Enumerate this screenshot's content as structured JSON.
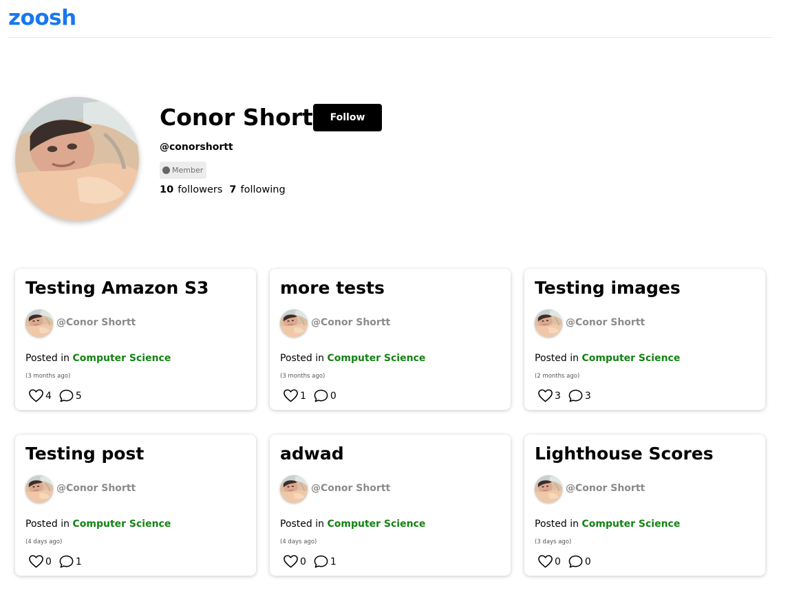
{
  "header": {
    "logo": "zoosh"
  },
  "profile": {
    "name": "Conor Shortt",
    "follow_label": "Follow",
    "handle": "@conorshortt",
    "badge": "Member",
    "followers_count": "10",
    "followers_label": "followers",
    "following_count": "7",
    "following_label": "following"
  },
  "posts": [
    {
      "title": "Testing Amazon S3",
      "author": "@Conor Shortt",
      "posted_prefix": "Posted in",
      "category": "Computer Science",
      "time": "(3 months ago)",
      "likes": "4",
      "comments": "5"
    },
    {
      "title": "more tests",
      "author": "@Conor Shortt",
      "posted_prefix": "Posted in",
      "category": "Computer Science",
      "time": "(3 months ago)",
      "likes": "1",
      "comments": "0"
    },
    {
      "title": "Testing images",
      "author": "@Conor Shortt",
      "posted_prefix": "Posted in",
      "category": "Computer Science",
      "time": "(2 months ago)",
      "likes": "3",
      "comments": "3"
    },
    {
      "title": "Testing post",
      "author": "@Conor Shortt",
      "posted_prefix": "Posted in",
      "category": "Computer Science",
      "time": "(4 days ago)",
      "likes": "0",
      "comments": "1"
    },
    {
      "title": "adwad",
      "author": "@Conor Shortt",
      "posted_prefix": "Posted in",
      "category": "Computer Science",
      "time": "(4 days ago)",
      "likes": "0",
      "comments": "1"
    },
    {
      "title": "Lighthouse Scores",
      "author": "@Conor Shortt",
      "posted_prefix": "Posted in",
      "category": "Computer Science",
      "time": "(3 days ago)",
      "likes": "0",
      "comments": "0"
    }
  ],
  "icons": {
    "like": "heart-icon",
    "comment": "comment-bubble-icon",
    "badge": "dot-icon"
  },
  "colors": {
    "logo": "#1877f2",
    "category": "#128212",
    "author": "#8a8a8a",
    "button": "#000000"
  }
}
